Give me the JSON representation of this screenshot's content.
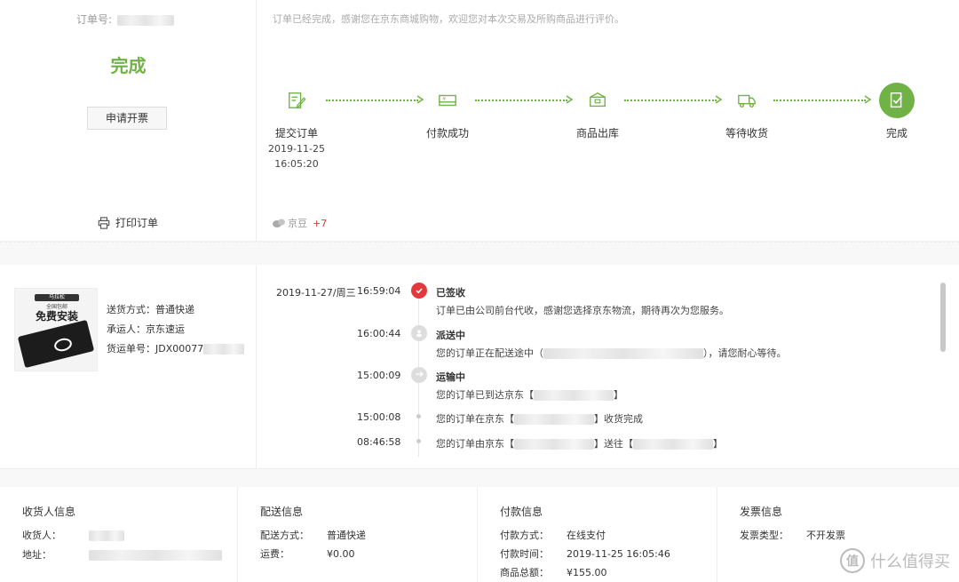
{
  "order": {
    "order_no_label": "订单号:",
    "status": "完成",
    "invoice_button": "申请开票",
    "print_label": "打印订单",
    "thanks_text": "订单已经完成，感谢您在京东商城购物，欢迎您对本次交易及所购商品进行评价。",
    "jd_bean_label": "京豆",
    "jd_bean_value": "+7"
  },
  "steps": [
    {
      "label": "提交订单",
      "date": "2019-11-25",
      "time": "16:05:20",
      "icon": "edit-icon"
    },
    {
      "label": "付款成功",
      "date": "",
      "time": "",
      "icon": "payment-icon"
    },
    {
      "label": "商品出库",
      "date": "",
      "time": "",
      "icon": "package-icon"
    },
    {
      "label": "等待收货",
      "date": "",
      "time": "",
      "icon": "truck-icon"
    },
    {
      "label": "完成",
      "date": "",
      "time": "",
      "icon": "check-doc-icon"
    }
  ],
  "product": {
    "tag": "马拉松",
    "tag2": "全国包邮",
    "free_install": "免费安装"
  },
  "shipping": {
    "method_label": "送货方式：",
    "method": "普通快递",
    "carrier_label": "承运人：",
    "carrier": "京东速运",
    "tracking_label": "货运单号：",
    "tracking": "JDX00077"
  },
  "tracking": [
    {
      "date": "2019-11-27/周三",
      "time": "16:59:04",
      "title": "已签收",
      "desc": "订单已由公司前台代收，感谢您选择京东物流，期待再次为您服务。"
    },
    {
      "date": "",
      "time": "16:00:44",
      "title": "派送中",
      "desc_before": "您的订单正在配送途中（",
      "desc_after": "），请您耐心等待。"
    },
    {
      "date": "",
      "time": "15:00:09",
      "title": "运输中",
      "desc_before": "您的订单已到达京东【",
      "desc_after": "】"
    },
    {
      "date": "",
      "time": "15:00:08",
      "desc_before": "您的订单在京东【",
      "desc_after": "】收货完成"
    },
    {
      "date": "",
      "time": "08:46:58",
      "desc_before": "您的订单由京东【",
      "desc_mid": "】送往【",
      "desc_after": "】"
    }
  ],
  "info": {
    "receiver": {
      "heading": "收货人信息",
      "name_label": "收货人：",
      "address_label": "地址："
    },
    "delivery": {
      "heading": "配送信息",
      "method_label": "配送方式：",
      "method": "普通快递",
      "fee_label": "运费：",
      "fee": "¥0.00"
    },
    "payment": {
      "heading": "付款信息",
      "method_label": "付款方式：",
      "method": "在线支付",
      "time_label": "付款时间：",
      "time": "2019-11-25 16:05:46",
      "total_label": "商品总额：",
      "total": "¥155.00"
    },
    "invoice": {
      "heading": "发票信息",
      "type_label": "发票类型：",
      "type": "不开发票"
    }
  },
  "watermark": {
    "badge": "值",
    "text": "什么值得买"
  },
  "colors": {
    "accent": "#71b247",
    "red": "#e4393c"
  }
}
